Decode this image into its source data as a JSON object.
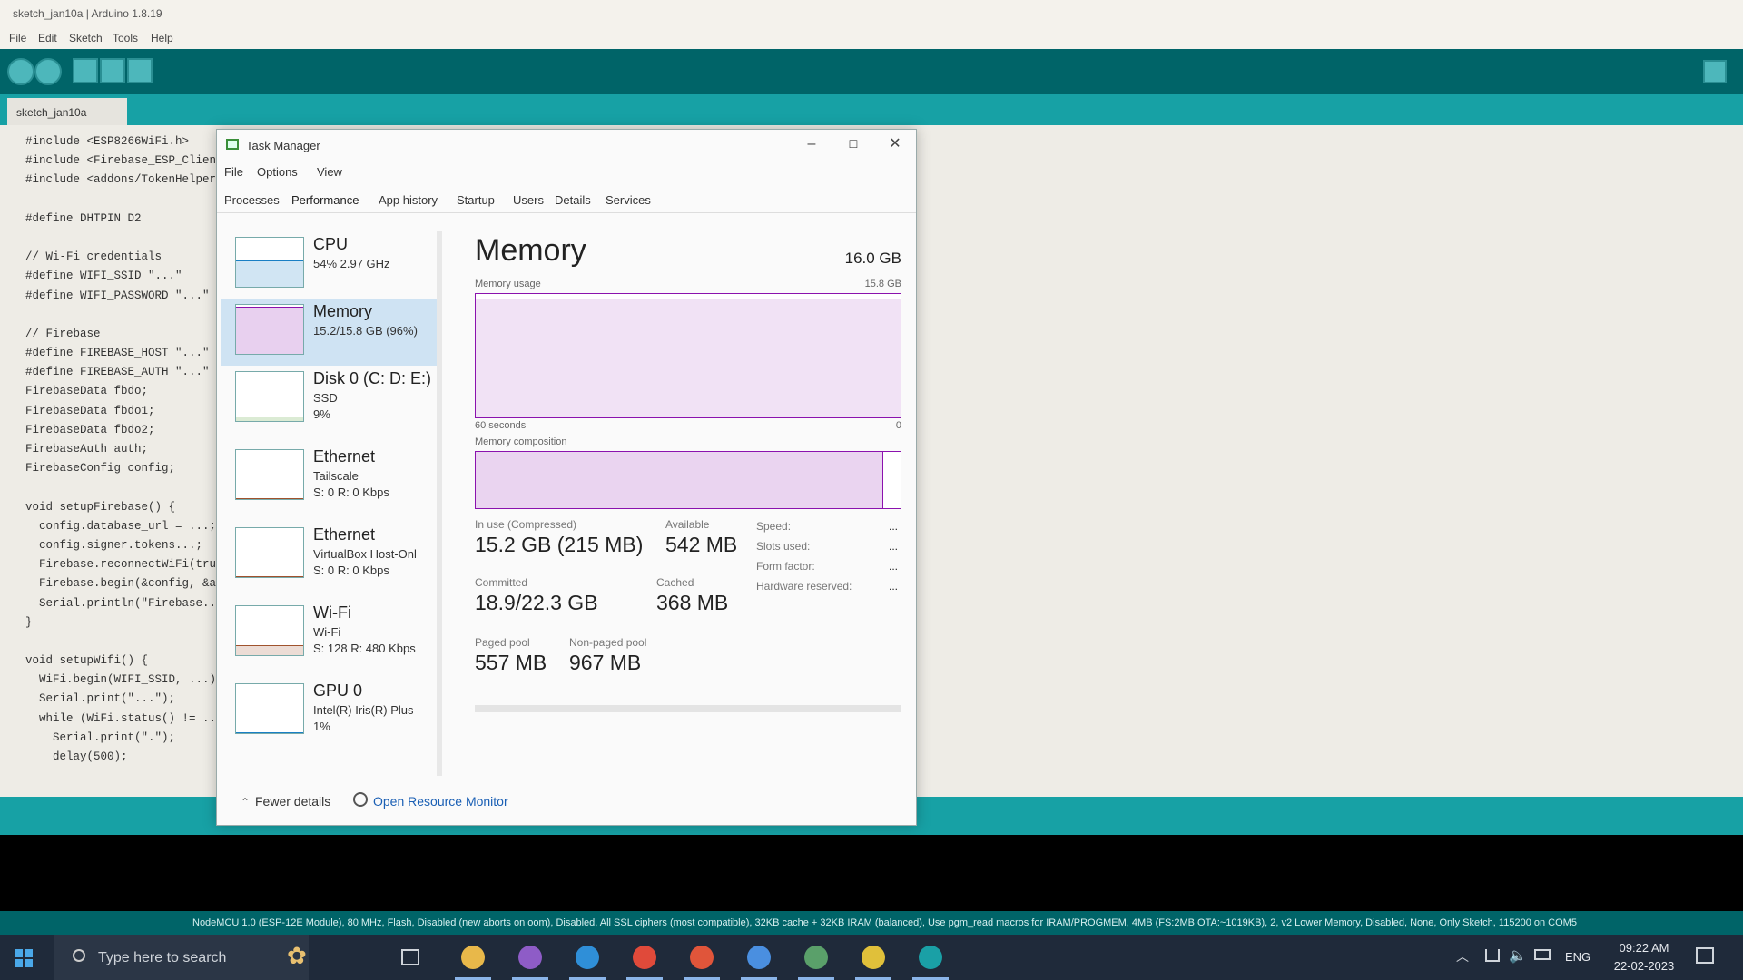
{
  "ide": {
    "title": "sketch_jan10a | Arduino 1.8.19",
    "menu": [
      "File",
      "Edit",
      "Sketch",
      "Tools",
      "Help"
    ],
    "tab_label": "sketch_jan10a",
    "code_lines": [
      "#include <ESP8266WiFi.h>",
      "#include <Firebase_ESP_Client.h>",
      "#include <addons/TokenHelper.h>",
      "",
      "#define DHTPIN D2",
      "",
      "// Wi-Fi credentials",
      "#define WIFI_SSID \"...\"",
      "#define WIFI_PASSWORD \"...\"",
      "",
      "// Firebase",
      "#define FIREBASE_HOST \"...\"",
      "#define FIREBASE_AUTH \"...\"",
      "FirebaseData fbdo;",
      "FirebaseData fbdo1;",
      "FirebaseData fbdo2;",
      "FirebaseAuth auth;",
      "FirebaseConfig config;",
      "",
      "void setupFirebase() {",
      "  config.database_url = ...;",
      "  config.signer.tokens...;",
      "  Firebase.reconnectWiFi(true);",
      "  Firebase.begin(&config, &auth);",
      "  Serial.println(\"Firebase...\");",
      "}",
      "",
      "void setupWifi() {",
      "  WiFi.begin(WIFI_SSID, ...);",
      "  Serial.print(\"...\");",
      "  while (WiFi.status() != ...",
      "    Serial.print(\".\");",
      "    delay(500);"
    ],
    "status_line": "NodeMCU 1.0 (ESP-12E Module), 80 MHz, Flash, Disabled (new aborts on oom), Disabled, All SSL ciphers (most compatible), 32KB cache + 32KB IRAM (balanced), Use pgm_read macros for IRAM/PROGMEM, 4MB (FS:2MB OTA:~1019KB), 2, v2 Lower Memory, Disabled, None, Only Sketch, 115200 on COM5"
  },
  "task_manager": {
    "title": "Task Manager",
    "window_controls": [
      "–",
      "☐",
      "✕"
    ],
    "menu": [
      "File",
      "Options",
      "View"
    ],
    "tabs": [
      "Processes",
      "Performance",
      "App history",
      "Startup",
      "Users",
      "Details",
      "Services"
    ],
    "active_tab": "Performance",
    "sidebar": [
      {
        "name": "CPU",
        "sub": "54% 2.97 GHz",
        "sub2": "",
        "level": 0.54,
        "color": "#1a7fc4"
      },
      {
        "name": "Memory",
        "sub": "15.2/15.8 GB (96%)",
        "sub2": "",
        "level": 0.96,
        "color": "#8b12ae"
      },
      {
        "name": "Disk 0 (C: D: E:)",
        "sub": "SSD",
        "sub2": "9%",
        "level": 0.09,
        "color": "#4c9a2a"
      },
      {
        "name": "Ethernet",
        "sub": "Tailscale",
        "sub2": "S: 0 R: 0 Kbps",
        "level": 0.0,
        "color": "#a0522d"
      },
      {
        "name": "Ethernet",
        "sub": "VirtualBox Host-Onl",
        "sub2": "S: 0 R: 0 Kbps",
        "level": 0.0,
        "color": "#a0522d"
      },
      {
        "name": "Wi-Fi",
        "sub": "Wi-Fi",
        "sub2": "S: 128 R: 480 Kbps",
        "level": 0.2,
        "color": "#a0522d"
      },
      {
        "name": "GPU 0",
        "sub": "Intel(R) Iris(R) Plus",
        "sub2": "1%",
        "level": 0.01,
        "color": "#1a7fc4"
      }
    ],
    "memory": {
      "title": "Memory",
      "total": "16.0 GB",
      "usage_label": "Memory usage",
      "usage_max": "15.8 GB",
      "usage_level": 0.96,
      "time_label": "60 seconds",
      "time_right": "0",
      "composition_label": "Memory composition",
      "composition_level": 0.96,
      "stats": {
        "in_use_label": "In use (Compressed)",
        "in_use": "15.2 GB (215 MB)",
        "available_label": "Available",
        "available": "542 MB",
        "committed_label": "Committed",
        "committed": "18.9/22.3 GB",
        "cached_label": "Cached",
        "cached": "368 MB",
        "paged_pool_label": "Paged pool",
        "paged_pool": "557 MB",
        "nonpaged_pool_label": "Non-paged pool",
        "nonpaged_pool": "967 MB"
      },
      "right_stats": [
        {
          "label": "Speed:",
          "value": "..."
        },
        {
          "label": "Slots used:",
          "value": "..."
        },
        {
          "label": "Form factor:",
          "value": "..."
        },
        {
          "label": "Hardware reserved:",
          "value": "..."
        }
      ]
    },
    "footer": {
      "fewer_details": "Fewer details",
      "resource_monitor": "Open Resource Monitor"
    }
  },
  "taskbar": {
    "search_placeholder": "Type here to search",
    "apps": [
      {
        "name": "file-explorer",
        "color": "#e8b84a"
      },
      {
        "name": "app-purple",
        "color": "#8e5cc7"
      },
      {
        "name": "vscode",
        "color": "#2f8fd8"
      },
      {
        "name": "chrome",
        "color": "#e04a3a"
      },
      {
        "name": "brave",
        "color": "#e0553a"
      },
      {
        "name": "chrome-2",
        "color": "#4a8fe0"
      },
      {
        "name": "task-manager",
        "color": "#5aa06a"
      },
      {
        "name": "app-yellow",
        "color": "#e0c03a"
      },
      {
        "name": "arduino",
        "color": "#1aa0a6"
      }
    ],
    "lang": "ENG",
    "time": "09:22 AM",
    "date": "22-02-2023"
  }
}
